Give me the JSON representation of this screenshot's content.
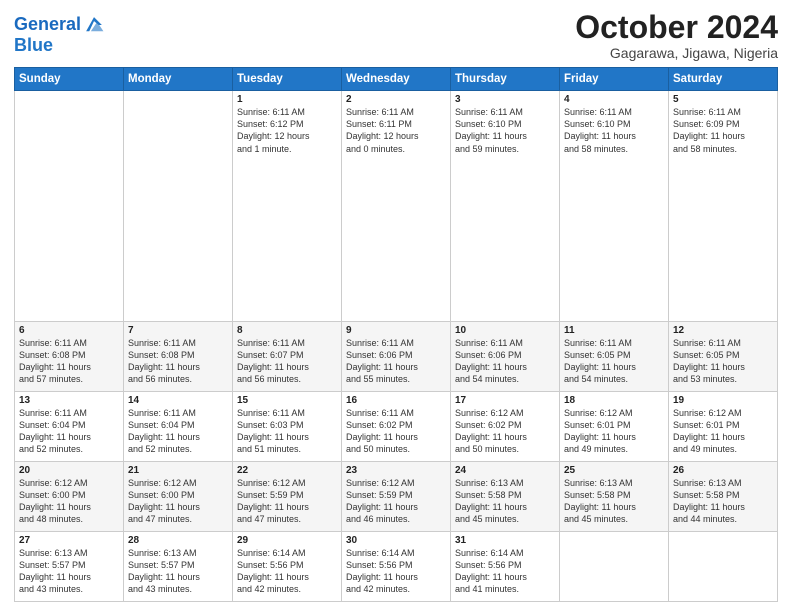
{
  "header": {
    "logo_general": "General",
    "logo_blue": "Blue",
    "month": "October 2024",
    "location": "Gagarawa, Jigawa, Nigeria"
  },
  "weekdays": [
    "Sunday",
    "Monday",
    "Tuesday",
    "Wednesday",
    "Thursday",
    "Friday",
    "Saturday"
  ],
  "weeks": [
    [
      {
        "day": "",
        "info": ""
      },
      {
        "day": "",
        "info": ""
      },
      {
        "day": "1",
        "info": "Sunrise: 6:11 AM\nSunset: 6:12 PM\nDaylight: 12 hours\nand 1 minute."
      },
      {
        "day": "2",
        "info": "Sunrise: 6:11 AM\nSunset: 6:11 PM\nDaylight: 12 hours\nand 0 minutes."
      },
      {
        "day": "3",
        "info": "Sunrise: 6:11 AM\nSunset: 6:10 PM\nDaylight: 11 hours\nand 59 minutes."
      },
      {
        "day": "4",
        "info": "Sunrise: 6:11 AM\nSunset: 6:10 PM\nDaylight: 11 hours\nand 58 minutes."
      },
      {
        "day": "5",
        "info": "Sunrise: 6:11 AM\nSunset: 6:09 PM\nDaylight: 11 hours\nand 58 minutes."
      }
    ],
    [
      {
        "day": "6",
        "info": "Sunrise: 6:11 AM\nSunset: 6:08 PM\nDaylight: 11 hours\nand 57 minutes."
      },
      {
        "day": "7",
        "info": "Sunrise: 6:11 AM\nSunset: 6:08 PM\nDaylight: 11 hours\nand 56 minutes."
      },
      {
        "day": "8",
        "info": "Sunrise: 6:11 AM\nSunset: 6:07 PM\nDaylight: 11 hours\nand 56 minutes."
      },
      {
        "day": "9",
        "info": "Sunrise: 6:11 AM\nSunset: 6:06 PM\nDaylight: 11 hours\nand 55 minutes."
      },
      {
        "day": "10",
        "info": "Sunrise: 6:11 AM\nSunset: 6:06 PM\nDaylight: 11 hours\nand 54 minutes."
      },
      {
        "day": "11",
        "info": "Sunrise: 6:11 AM\nSunset: 6:05 PM\nDaylight: 11 hours\nand 54 minutes."
      },
      {
        "day": "12",
        "info": "Sunrise: 6:11 AM\nSunset: 6:05 PM\nDaylight: 11 hours\nand 53 minutes."
      }
    ],
    [
      {
        "day": "13",
        "info": "Sunrise: 6:11 AM\nSunset: 6:04 PM\nDaylight: 11 hours\nand 52 minutes."
      },
      {
        "day": "14",
        "info": "Sunrise: 6:11 AM\nSunset: 6:04 PM\nDaylight: 11 hours\nand 52 minutes."
      },
      {
        "day": "15",
        "info": "Sunrise: 6:11 AM\nSunset: 6:03 PM\nDaylight: 11 hours\nand 51 minutes."
      },
      {
        "day": "16",
        "info": "Sunrise: 6:11 AM\nSunset: 6:02 PM\nDaylight: 11 hours\nand 50 minutes."
      },
      {
        "day": "17",
        "info": "Sunrise: 6:12 AM\nSunset: 6:02 PM\nDaylight: 11 hours\nand 50 minutes."
      },
      {
        "day": "18",
        "info": "Sunrise: 6:12 AM\nSunset: 6:01 PM\nDaylight: 11 hours\nand 49 minutes."
      },
      {
        "day": "19",
        "info": "Sunrise: 6:12 AM\nSunset: 6:01 PM\nDaylight: 11 hours\nand 49 minutes."
      }
    ],
    [
      {
        "day": "20",
        "info": "Sunrise: 6:12 AM\nSunset: 6:00 PM\nDaylight: 11 hours\nand 48 minutes."
      },
      {
        "day": "21",
        "info": "Sunrise: 6:12 AM\nSunset: 6:00 PM\nDaylight: 11 hours\nand 47 minutes."
      },
      {
        "day": "22",
        "info": "Sunrise: 6:12 AM\nSunset: 5:59 PM\nDaylight: 11 hours\nand 47 minutes."
      },
      {
        "day": "23",
        "info": "Sunrise: 6:12 AM\nSunset: 5:59 PM\nDaylight: 11 hours\nand 46 minutes."
      },
      {
        "day": "24",
        "info": "Sunrise: 6:13 AM\nSunset: 5:58 PM\nDaylight: 11 hours\nand 45 minutes."
      },
      {
        "day": "25",
        "info": "Sunrise: 6:13 AM\nSunset: 5:58 PM\nDaylight: 11 hours\nand 45 minutes."
      },
      {
        "day": "26",
        "info": "Sunrise: 6:13 AM\nSunset: 5:58 PM\nDaylight: 11 hours\nand 44 minutes."
      }
    ],
    [
      {
        "day": "27",
        "info": "Sunrise: 6:13 AM\nSunset: 5:57 PM\nDaylight: 11 hours\nand 43 minutes."
      },
      {
        "day": "28",
        "info": "Sunrise: 6:13 AM\nSunset: 5:57 PM\nDaylight: 11 hours\nand 43 minutes."
      },
      {
        "day": "29",
        "info": "Sunrise: 6:14 AM\nSunset: 5:56 PM\nDaylight: 11 hours\nand 42 minutes."
      },
      {
        "day": "30",
        "info": "Sunrise: 6:14 AM\nSunset: 5:56 PM\nDaylight: 11 hours\nand 42 minutes."
      },
      {
        "day": "31",
        "info": "Sunrise: 6:14 AM\nSunset: 5:56 PM\nDaylight: 11 hours\nand 41 minutes."
      },
      {
        "day": "",
        "info": ""
      },
      {
        "day": "",
        "info": ""
      }
    ]
  ]
}
